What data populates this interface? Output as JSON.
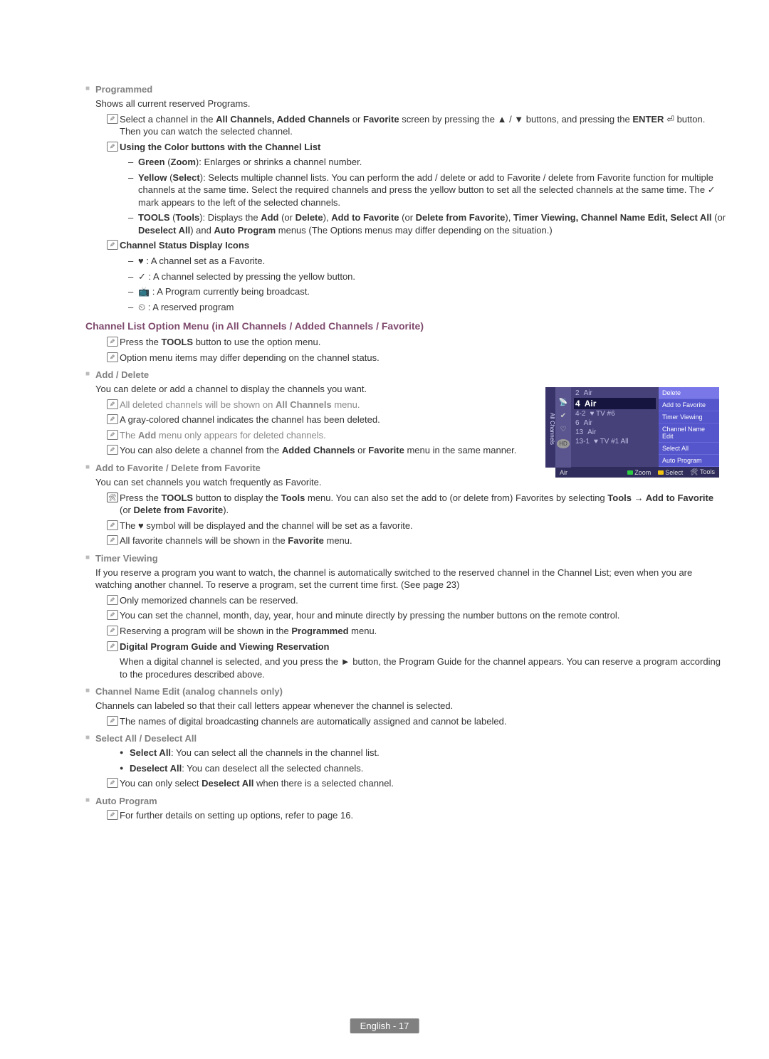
{
  "sections": {
    "programmed": {
      "title": "Programmed",
      "intro": "Shows all current reserved Programs.",
      "note_select": "Select a channel in the All Channels, Added Channels or Favorite screen by pressing the ▲ / ▼ buttons, and pressing the ENTER ⏎ button. Then you can watch the selected channel.",
      "note_using_title": "Using the Color buttons with the Channel List",
      "items": {
        "green": "Green (Zoom): Enlarges or shrinks a channel number.",
        "yellow": "Yellow (Select): Selects multiple channel lists. You can perform the add / delete or add to Favorite / delete from Favorite function for multiple channels at the same time. Select the required channels and press the yellow button to set all the selected channels at the same time. The ✓ mark appears to the left of the selected channels.",
        "tools": "TOOLS (Tools): Displays the Add (or Delete), Add to Favorite (or Delete from Favorite), Timer Viewing, Channel Name Edit, Select All (or Deselect All) and Auto Program menus (The Options menus may differ depending on the situation.)"
      },
      "status_title": "Channel Status Display Icons",
      "status": {
        "heart": "♥ : A channel set as a Favorite.",
        "check": "✓ : A channel selected by pressing the yellow button.",
        "broadcast": " 📺  : A Program currently being broadcast.",
        "clock": "⏲ : A reserved program"
      }
    },
    "option_menu_title": "Channel List Option Menu (in All Channels / Added Channels / Favorite)",
    "option_notes": {
      "a": "Press the TOOLS button to use the option menu.",
      "b": "Option menu items may differ depending on the channel status."
    },
    "add_delete": {
      "title": "Add / Delete",
      "intro": "You can delete or add a channel to display the channels you want.",
      "n1": "All deleted channels will be shown on All Channels menu.",
      "n2": "A gray-colored channel indicates the channel has been deleted.",
      "n3": "The Add menu only appears for deleted channels.",
      "n4": "You can also delete a channel from the Added Channels or Favorite menu in the same manner."
    },
    "favorite": {
      "title": "Add to Favorite / Delete from Favorite",
      "intro": "You can set channels you watch frequently as Favorite.",
      "tool": "Press the TOOLS button to display the Tools menu. You can also set the add to (or delete from) Favorites by selecting Tools → Add to Favorite (or Delete from Favorite).",
      "n1": "The ♥ symbol will be displayed and the channel will be set as a favorite.",
      "n2": "All favorite channels will be shown in the Favorite menu."
    },
    "timer": {
      "title": "Timer Viewing",
      "intro": "If you reserve a program you want to watch, the channel is automatically switched to the reserved channel in the Channel List; even when you are watching another channel. To reserve a program, set the current time first. (See page 23)",
      "n1": "Only memorized channels can be reserved.",
      "n2": "You can set the channel, month, day, year, hour and minute directly by pressing the number buttons on the remote control.",
      "n3": "Reserving a program will be shown in the Programmed menu.",
      "digital_title": "Digital Program Guide and Viewing Reservation",
      "digital_body": "When a digital channel is selected, and you press the ► button, the Program Guide for the channel appears. You can reserve a program according to the procedures described above."
    },
    "name_edit": {
      "title": "Channel Name Edit (analog channels only)",
      "intro": "Channels can labeled so that their call letters appear whenever the channel is selected.",
      "n1": "The names of digital broadcasting channels are automatically assigned and cannot be labeled."
    },
    "select_all": {
      "title": "Select All / Deselect All",
      "b1": "Select All: You can select all the channels in the channel list.",
      "b2": "Deselect All: You can deselect all the selected channels.",
      "n1": "You can only select Deselect All when there is a selected channel."
    },
    "auto": {
      "title": "Auto Program",
      "n1": "For further details on setting up options, refer to page 16."
    }
  },
  "tv": {
    "tab": "All Channels",
    "rows": [
      {
        "num": "2",
        "name": "Air"
      },
      {
        "num": "4",
        "name": "Air"
      },
      {
        "num": "4-2",
        "name": "♥ TV #6"
      },
      {
        "num": "6",
        "name": "Air"
      },
      {
        "num": "13",
        "name": "Air"
      },
      {
        "num": "13-1",
        "name": "♥ TV #1   All"
      }
    ],
    "menu": [
      "Delete",
      "Add to Favorite",
      "Timer Viewing",
      "Channel Name Edit",
      "Select All",
      "Auto Program"
    ],
    "footer_left": "Air",
    "footer_zoom": "Zoom",
    "footer_select": "Select",
    "footer_tools": "🛠 Tools"
  },
  "footer": "English - 17"
}
